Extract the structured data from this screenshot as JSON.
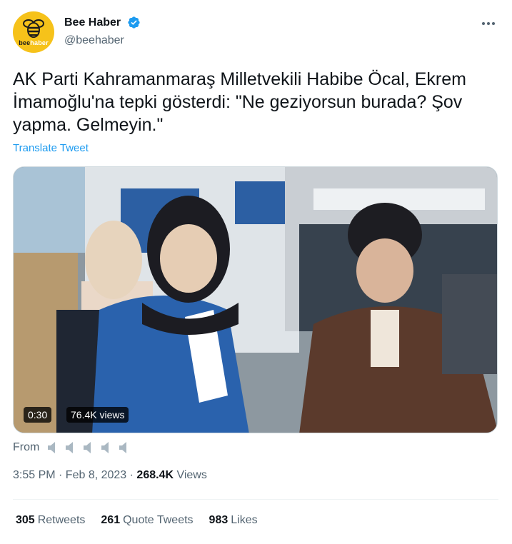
{
  "author": {
    "display_name": "Bee Haber",
    "handle": "@beehaber",
    "avatar_logo_text_a": "bee",
    "avatar_logo_text_b": "haber",
    "verified_icon": "verified-badge-icon",
    "brand_color": "#f6c21a"
  },
  "tweet": {
    "text": "AK Parti Kahramanmaraş Milletvekili Habibe Öcal, Ekrem İmamoğlu'na tepki gösterdi: \"Ne geziyorsun burada? Şov yapma. Gelmeyin.\"",
    "translate_label": "Translate Tweet",
    "video": {
      "duration": "0:30",
      "views": "76.4K views"
    },
    "from_label": "From",
    "timestamp": "3:55 PM · Feb 8, 2023 · ",
    "views_count": "268.4K",
    "views_label": " Views"
  },
  "stats": {
    "retweets_count": "305",
    "retweets_label": "Retweets",
    "quotes_count": "261",
    "quotes_label": "Quote Tweets",
    "likes_count": "983",
    "likes_label": "Likes"
  },
  "colors": {
    "link": "#1d9bf0",
    "secondary_text": "#536471",
    "primary_text": "#0f1419"
  }
}
